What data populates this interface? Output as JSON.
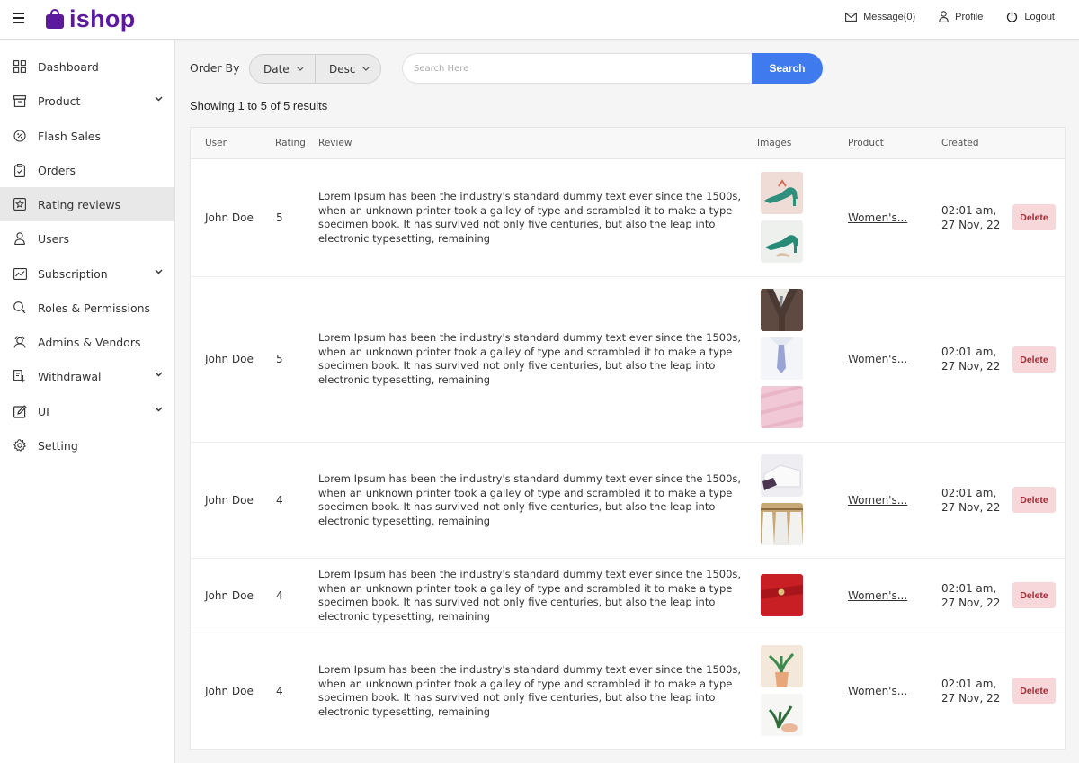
{
  "app": {
    "logo_text": "ishop",
    "brand_color": "#5b1a9e"
  },
  "topbar": {
    "message_label": "Message(0)",
    "profile_label": "Profile",
    "logout_label": "Logout"
  },
  "sidebar": {
    "items": [
      {
        "label": "Dashboard",
        "icon": "dashboard-icon",
        "has_chevron": false
      },
      {
        "label": "Product",
        "icon": "product-box-icon",
        "has_chevron": true
      },
      {
        "label": "Flash Sales",
        "icon": "flash-sales-icon",
        "has_chevron": false
      },
      {
        "label": "Orders",
        "icon": "orders-clipboard-icon",
        "has_chevron": false
      },
      {
        "label": "Rating reviews",
        "icon": "rating-star-icon",
        "has_chevron": false,
        "active": true
      },
      {
        "label": "Users",
        "icon": "user-icon",
        "has_chevron": false
      },
      {
        "label": "Subscription",
        "icon": "subscription-chart-icon",
        "has_chevron": true
      },
      {
        "label": "Roles & Permissions",
        "icon": "roles-key-icon",
        "has_chevron": false
      },
      {
        "label": "Admins & Vendors",
        "icon": "admins-icon",
        "has_chevron": false
      },
      {
        "label": "Withdrawal",
        "icon": "withdrawal-icon",
        "has_chevron": true
      },
      {
        "label": "UI",
        "icon": "ui-edit-icon",
        "has_chevron": true
      },
      {
        "label": "Setting",
        "icon": "gear-icon",
        "has_chevron": false
      }
    ]
  },
  "filters": {
    "order_by_label": "Order By",
    "sort_field": "Date",
    "sort_direction": "Desc",
    "search_placeholder": "Search Here",
    "search_button": "Search"
  },
  "results_text": "Showing 1 to 5 of 5 results",
  "table": {
    "headers": {
      "user": "User",
      "rating": "Rating",
      "review": "Review",
      "images": "Images",
      "product": "Product",
      "created": "Created"
    },
    "delete_label": "Delete",
    "rows": [
      {
        "user": "John Doe",
        "rating": "5",
        "review": "Lorem Ipsum has been the industry's standard dummy text ever since the 1500s, when an unknown printer took a galley of type and scrambled it to make a type specimen book. It has survived not only five centuries, but also the leap into electronic typesetting, remaining",
        "product": "Women's...",
        "created_time": "02:01 am,",
        "created_date": "27 Nov, 22",
        "images": [
          "green-heel-shoe-photo",
          "green-heel-shoe-photo-2"
        ]
      },
      {
        "user": "John Doe",
        "rating": "5",
        "review": "Lorem Ipsum has been the industry's standard dummy text ever since the 1500s, when an unknown printer took a galley of type and scrambled it to make a type specimen book. It has survived not only five centuries, but also the leap into electronic typesetting, remaining",
        "product": "Women's...",
        "created_time": "02:01 am,",
        "created_date": "27 Nov, 22",
        "images": [
          "suit-vest-photo",
          "shirt-tie-photo",
          "pink-fabric-photo"
        ]
      },
      {
        "user": "John Doe",
        "rating": "4",
        "review": "Lorem Ipsum has been the industry's standard dummy text ever since the 1500s, when an unknown printer took a galley of type and scrambled it to make a type specimen book. It has survived not only five centuries, but also the leap into electronic typesetting, remaining",
        "product": "Women's...",
        "created_time": "02:01 am,",
        "created_date": "27 Nov, 22",
        "images": [
          "white-shirt-folded-photo",
          "shirts-on-rack-photo"
        ]
      },
      {
        "user": "John Doe",
        "rating": "4",
        "review": "Lorem Ipsum has been the industry's standard dummy text ever since the 1500s, when an unknown printer took a galley of type and scrambled it to make a type specimen book. It has survived not only five centuries, but also the leap into electronic typesetting, remaining",
        "product": "Women's...",
        "created_time": "02:01 am,",
        "created_date": "27 Nov, 22",
        "images": [
          "red-wallet-photo"
        ]
      },
      {
        "user": "John Doe",
        "rating": "4",
        "review": "Lorem Ipsum has been the industry's standard dummy text ever since the 1500s, when an unknown printer took a galley of type and scrambled it to make a type specimen book. It has survived not only five centuries, but also the leap into electronic typesetting, remaining",
        "product": "Women's...",
        "created_time": "02:01 am,",
        "created_date": "27 Nov, 22",
        "images": [
          "potted-plant-photo",
          "hands-plant-photo"
        ]
      }
    ]
  }
}
